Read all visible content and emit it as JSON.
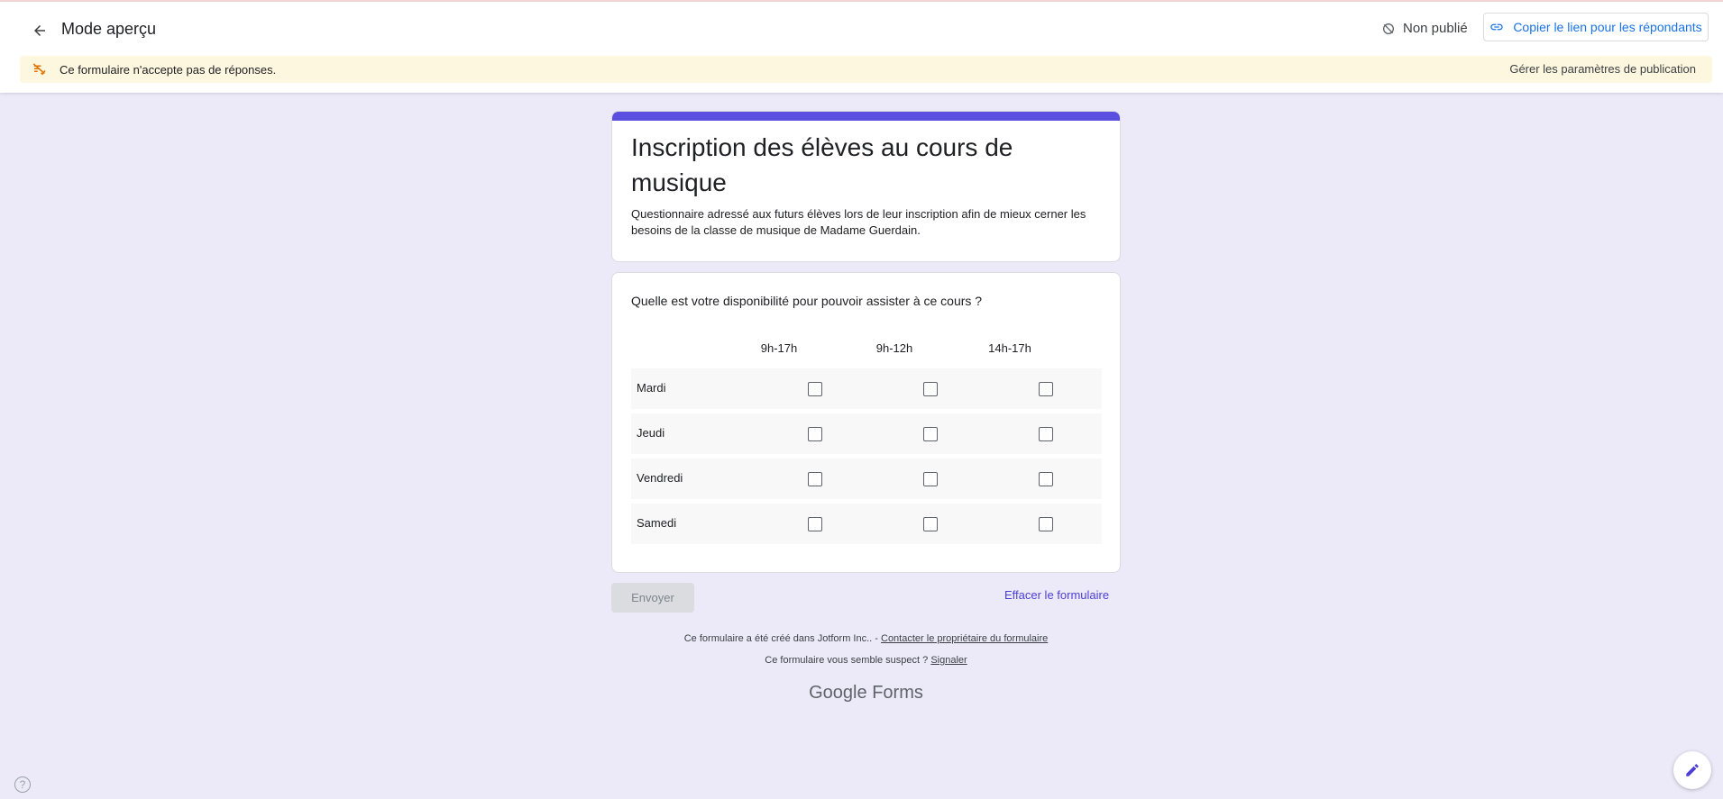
{
  "header": {
    "mode_title": "Mode aperçu",
    "status": "Non publié",
    "copy_link_label": "Copier le lien pour les répondants"
  },
  "banner": {
    "message": "Ce formulaire n'accepte pas de réponses.",
    "settings_link": "Gérer les paramètres de publication"
  },
  "form": {
    "title": "Inscription des élèves au cours de musique",
    "description": "Questionnaire adressé aux futurs élèves lors de leur inscription afin de mieux cerner les besoins de la classe de musique de Madame Guerdain.",
    "accent_color": "#5b4fe0"
  },
  "question": {
    "title": "Quelle est votre disponibilité pour pouvoir assister à ce cours ?",
    "columns": [
      "9h-17h",
      "9h-12h",
      "14h-17h"
    ],
    "rows": [
      "Mardi",
      "Jeudi",
      "Vendredi",
      "Samedi"
    ]
  },
  "actions": {
    "submit_label": "Envoyer",
    "clear_label": "Effacer le formulaire"
  },
  "footer": {
    "created_text": "Ce formulaire a été créé dans Jotform Inc.. - ",
    "contact_link": "Contacter le propriétaire du formulaire",
    "suspect_text": "Ce formulaire vous semble suspect ? ",
    "report_link": "Signaler",
    "logo_google": "Google",
    "logo_forms": "Forms"
  },
  "misc": {
    "help_glyph": "?"
  }
}
